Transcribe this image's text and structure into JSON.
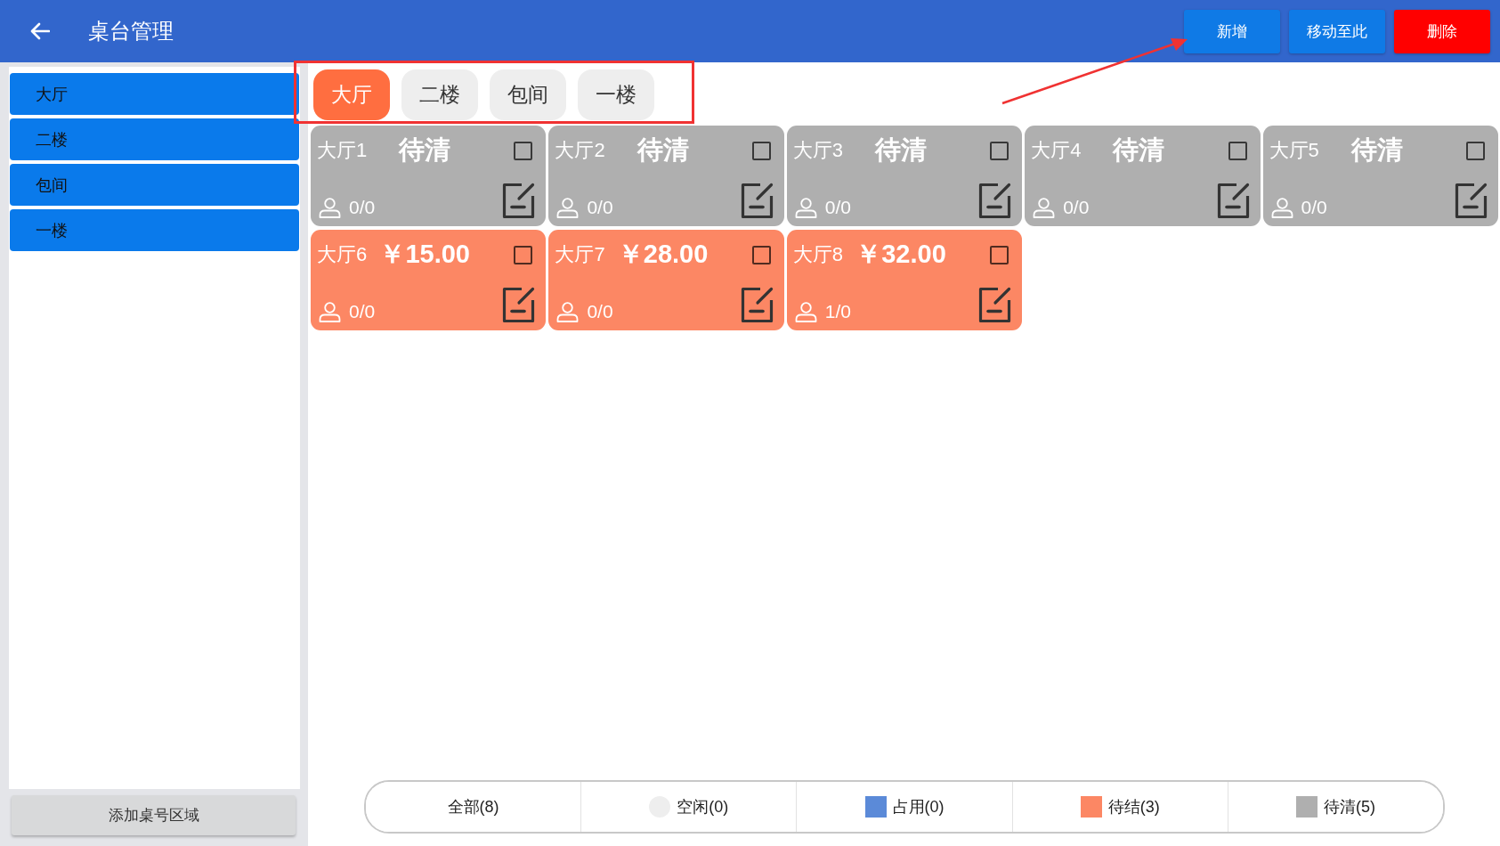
{
  "header": {
    "title": "桌台管理",
    "buttons": [
      {
        "label": "新增",
        "kind": "primary"
      },
      {
        "label": "移动至此",
        "kind": "primary"
      },
      {
        "label": "删除",
        "kind": "danger"
      }
    ]
  },
  "sidebar": {
    "items": [
      {
        "label": "大厅"
      },
      {
        "label": "二楼"
      },
      {
        "label": "包间"
      },
      {
        "label": "一楼"
      }
    ],
    "add_button": "添加桌号区域"
  },
  "tabs": [
    {
      "label": "大厅",
      "selected": true
    },
    {
      "label": "二楼",
      "selected": false
    },
    {
      "label": "包间",
      "selected": false
    },
    {
      "label": "一楼",
      "selected": false
    }
  ],
  "tables": [
    {
      "name": "大厅1",
      "headline": "待清",
      "guests": "0/0",
      "color": "#afafaf",
      "checked": false
    },
    {
      "name": "大厅2",
      "headline": "待清",
      "guests": "0/0",
      "color": "#afafaf",
      "checked": false
    },
    {
      "name": "大厅3",
      "headline": "待清",
      "guests": "0/0",
      "color": "#afafaf",
      "checked": false
    },
    {
      "name": "大厅4",
      "headline": "待清",
      "guests": "0/0",
      "color": "#afafaf",
      "checked": false
    },
    {
      "name": "大厅5",
      "headline": "待清",
      "guests": "0/0",
      "color": "#afafaf",
      "checked": false
    },
    {
      "name": "大厅6",
      "headline": "￥15.00",
      "guests": "0/0",
      "color": "#fc8764",
      "checked": false
    },
    {
      "name": "大厅7",
      "headline": "￥28.00",
      "guests": "0/0",
      "color": "#fc8764",
      "checked": false
    },
    {
      "name": "大厅8",
      "headline": "￥32.00",
      "guests": "1/0",
      "color": "#fc8764",
      "checked": false
    }
  ],
  "legend": [
    {
      "label": "全部(8)",
      "kind": "text"
    },
    {
      "label": "空闲(0)",
      "kind": "circle",
      "color": "#eeeeee"
    },
    {
      "label": "占用(0)",
      "kind": "square",
      "color": "#5b8ad8"
    },
    {
      "label": "待结(3)",
      "kind": "square",
      "color": "#fc8764"
    },
    {
      "label": "待清(5)",
      "kind": "square",
      "color": "#afafaf"
    }
  ]
}
